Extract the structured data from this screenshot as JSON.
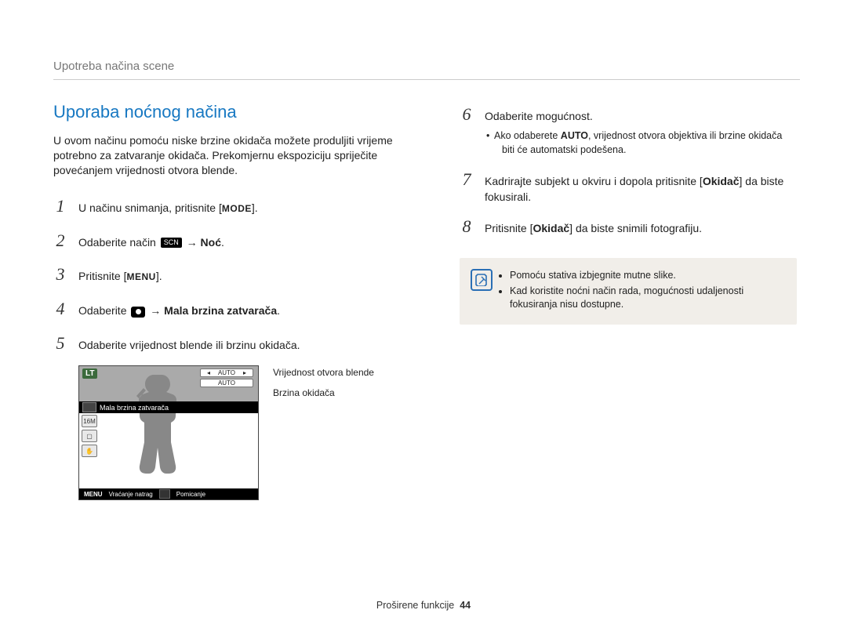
{
  "breadcrumb": "Upotreba načina scene",
  "title": "Uporaba noćnog načina",
  "intro": "U ovom načinu pomoću niske brzine okidača možete produljiti vrijeme potrebno za zatvaranje okidača. Prekomjernu ekspoziciju spriječite povećanjem vrijednosti otvora blende.",
  "steps_left": [
    {
      "n": "1",
      "pre": "U načinu snimanja, pritisnite [",
      "label": "MODE",
      "post": "]."
    },
    {
      "n": "2",
      "pre": "Odaberite način ",
      "iconText": "SCN",
      "arrow": " → ",
      "boldAfter": "Noć",
      "post": "."
    },
    {
      "n": "3",
      "pre": "Pritisnite [",
      "label": "MENU",
      "post": "]."
    },
    {
      "n": "4",
      "pre": "Odaberite ",
      "iconCam": true,
      "arrow": " → ",
      "boldAfter": "Mala brzina zatvarača",
      "post": "."
    },
    {
      "n": "5",
      "pre": "Odaberite vrijednost blende ili brzinu okidača."
    }
  ],
  "lcd": {
    "lt": "LT",
    "auto": "AUTO",
    "blackbar": "Mala brzina zatvarača",
    "icon_16m": "16M",
    "bottom_menu": "MENU",
    "bottom_back": "Vraćanje natrag",
    "bottom_move": "Pomicanje"
  },
  "callouts": {
    "aperture": "Vrijednost otvora blende",
    "shutter": "Brzina okidača"
  },
  "steps_right": [
    {
      "n": "6",
      "pre": "Odaberite mogućnost.",
      "note": {
        "text_before": "Ako odaberete ",
        "bold": "AUTO",
        "text_after": ", vrijednost otvora objektiva ili brzine okidača biti će automatski podešena."
      }
    },
    {
      "n": "7",
      "pre": "Kadrirajte subjekt u okviru i dopola pritisnite [",
      "bold_in": "Okidač",
      "mid": "] da biste fokusirali."
    },
    {
      "n": "8",
      "pre": "Pritisnite [",
      "bold_in": "Okidač",
      "mid": "] da biste snimili fotografiju."
    }
  ],
  "infobox": {
    "items": [
      "Pomoću stativa izbjegnite mutne slike.",
      "Kad koristite noćni način rada, mogućnosti udaljenosti fokusiranja nisu dostupne."
    ]
  },
  "footer": {
    "section": "Proširene funkcije",
    "page": "44"
  }
}
